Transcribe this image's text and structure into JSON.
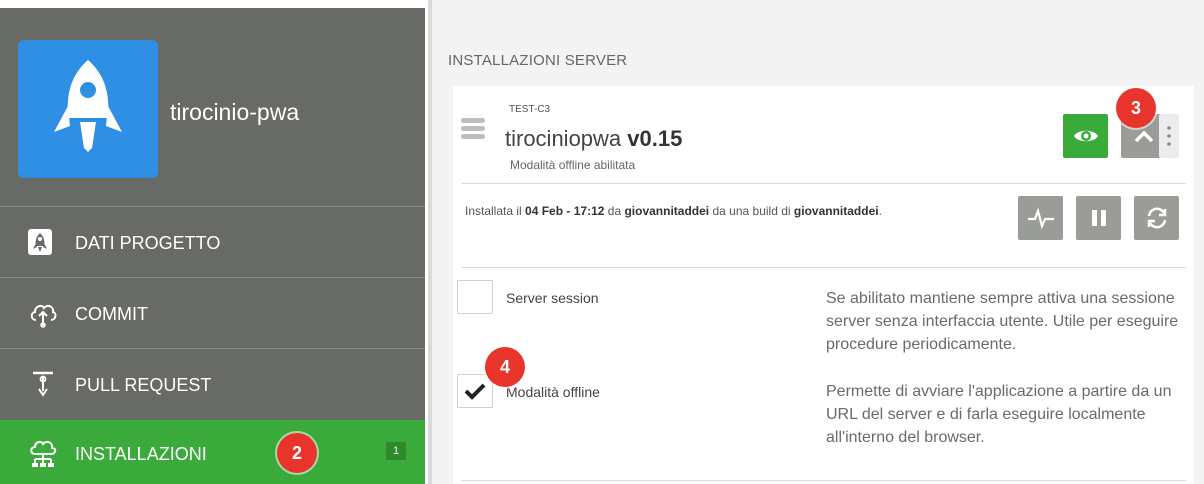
{
  "sidebar": {
    "project_name": "tirocinio-pwa",
    "items": [
      {
        "label": "DATI PROGETTO",
        "icon": "rocket-icon"
      },
      {
        "label": "COMMIT",
        "icon": "cloud-upload-icon"
      },
      {
        "label": "PULL REQUEST",
        "icon": "pull-request-icon"
      },
      {
        "label": "INSTALLAZIONI",
        "icon": "network-cloud-icon",
        "badge": "1",
        "active": true
      }
    ]
  },
  "callouts": {
    "installazioni": "2",
    "collapse": "3",
    "offline": "4"
  },
  "main": {
    "section_title": "INSTALLAZIONI SERVER",
    "server": {
      "env": "TEST-C3",
      "name": "tirociniopwa",
      "version": "v0.15",
      "status": "Modalità offline abilitata"
    },
    "install_info": {
      "prefix": "Installata il",
      "date": "04 Feb - 17:12",
      "by_text": "da",
      "user1": "giovannitaddei",
      "build_text": "da una build di",
      "user2": "giovannitaddei",
      "end": "."
    },
    "options": [
      {
        "label": "Server session",
        "checked": false,
        "description": "Se abilitato mantiene sempre attiva una sessione server senza interfaccia utente. Utile per eseguire procedure periodicamente."
      },
      {
        "label": "Modalità offline",
        "checked": true,
        "description": "Permette di avviare l'applicazione a partire da un URL del server e di farla eseguire localmente all'interno del browser."
      }
    ]
  },
  "colors": {
    "green": "#3aaa3a",
    "sidebar": "#686a66",
    "gray_button": "#9a9c98",
    "callout": "#e8342a",
    "logo_blue": "#2f8fe5"
  }
}
